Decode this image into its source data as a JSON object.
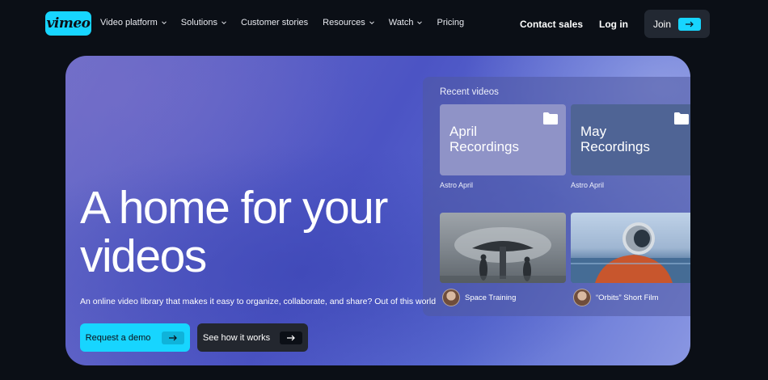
{
  "nav": {
    "logo_text": "vimeo",
    "items": [
      {
        "label": "Video platform",
        "dropdown": true
      },
      {
        "label": "Solutions",
        "dropdown": true
      },
      {
        "label": "Customer stories",
        "dropdown": false
      },
      {
        "label": "Resources",
        "dropdown": true
      },
      {
        "label": "Watch",
        "dropdown": true
      },
      {
        "label": "Pricing",
        "dropdown": false
      }
    ],
    "contact_sales": "Contact sales",
    "log_in": "Log in",
    "join": "Join"
  },
  "hero": {
    "headline": "A home for your videos",
    "subtitle": "An online video library that makes it easy to organize, collaborate, and share? Out of this world",
    "cta_primary": "Request a demo",
    "cta_secondary": "See how it works"
  },
  "recent_videos": {
    "title": "Recent videos",
    "folders": [
      {
        "name": "April Recordings",
        "owner": "Astro April"
      },
      {
        "name": "May Recordings",
        "owner": "Astro April"
      }
    ],
    "videos": [
      {
        "title": "Space Training"
      },
      {
        "title": "“Orbits” Short Film"
      }
    ]
  },
  "colors": {
    "accent": "#17d5ff",
    "background": "#0b0f16",
    "dark_button": "#23272f"
  },
  "icons": [
    "chevron-down-icon",
    "arrow-right-icon",
    "folder-icon"
  ]
}
